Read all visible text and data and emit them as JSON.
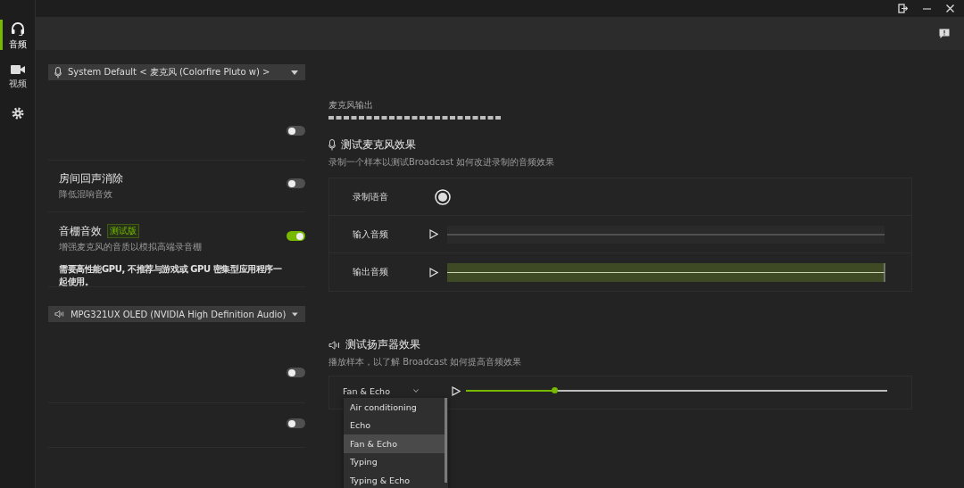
{
  "nav": [
    {
      "kind": "headset",
      "label": "音频",
      "selected": true
    },
    {
      "kind": "camera",
      "label": "视频",
      "selected": false
    },
    {
      "kind": "gear",
      "selected": false
    }
  ],
  "microphone": {
    "device": "System Default < 麦克风 (Colorfire Pluto w) >",
    "settings": [
      {
        "on": false
      },
      {
        "title": "房间回声消除",
        "subtitle": "降低混响音效",
        "on": false
      },
      {
        "title": "音棚音效",
        "badge": "测试版",
        "subtitle": "增强麦克风的音质以模拟高端录音棚",
        "note": "需要高性能GPU, 不推荐与游戏或 GPU 密集型应用程序一起使用。",
        "on": true
      }
    ]
  },
  "speaker": {
    "device": "MPG321UX OLED (NVIDIA High Definition Audio)",
    "settings": [
      {
        "on": false
      },
      {
        "on": false
      }
    ]
  },
  "mic_test": {
    "output_label": "麦克风输出",
    "title": "测试麦克风效果",
    "subtitle": "录制一个样本以测试Broadcast 如何改进录制的音频效果",
    "rows": [
      {
        "kind": "record",
        "label": "录制语音"
      },
      {
        "kind": "input",
        "label": "输入音频"
      },
      {
        "kind": "output",
        "label": "输出音频"
      }
    ]
  },
  "speaker_test": {
    "title": "测试扬声器效果",
    "subtitle": "播放样本，以了解 Broadcast 如何提高音频效果",
    "sample": "Fan & Echo",
    "level": 0.21,
    "menu": [
      {
        "label": "Air conditioning",
        "selected": false
      },
      {
        "label": "Echo",
        "selected": false
      },
      {
        "label": "Fan & Echo",
        "selected": true
      },
      {
        "label": "Typing",
        "selected": false
      },
      {
        "label": "Typing & Echo",
        "selected": false
      }
    ]
  }
}
